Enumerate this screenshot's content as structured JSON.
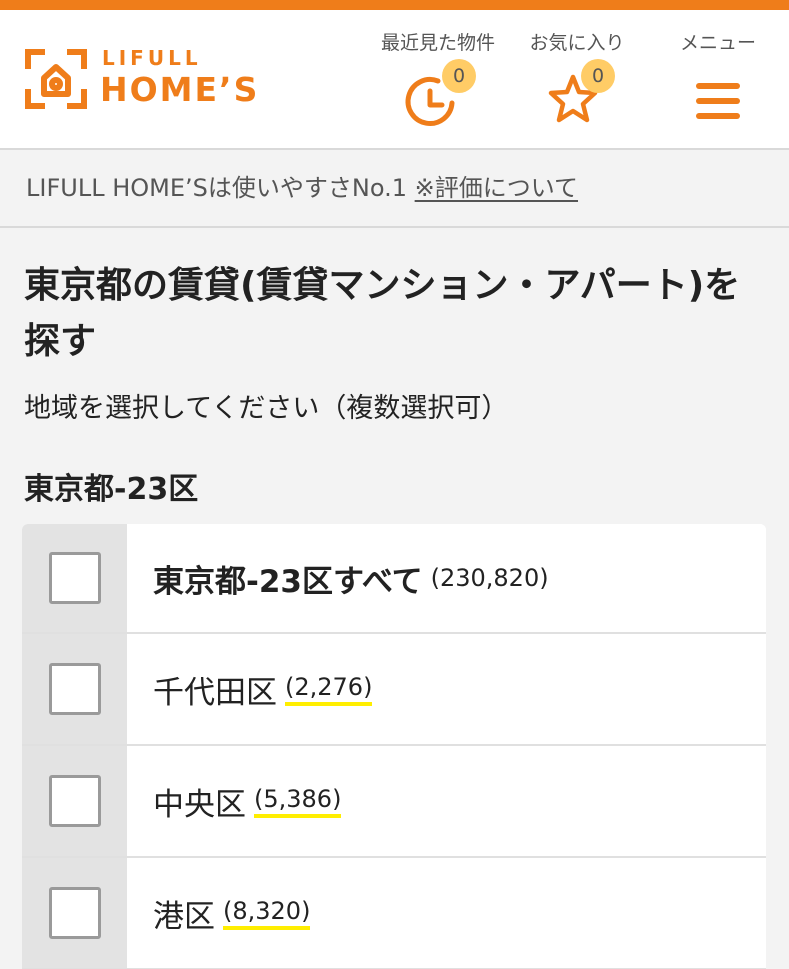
{
  "brand": {
    "logo_small": "LIFULL",
    "logo_big": "HOME’S",
    "color": "#ef7d1a"
  },
  "header": {
    "recent": {
      "label": "最近見た物件",
      "count": "0",
      "icon": "clock-icon"
    },
    "favorites": {
      "label": "お気に入り",
      "count": "0",
      "icon": "star-icon"
    },
    "menu": {
      "label": "メニュー",
      "icon": "hamburger-menu-icon"
    }
  },
  "info_bar": {
    "text": "LIFULL HOME’Sは使いやすさNo.1",
    "link": "※評価について"
  },
  "page": {
    "title": "東京都の賃貸(賃貸マンション・アパート)を探す",
    "instruction": "地域を選択してください（複数選択可）",
    "section_title": "東京都-23区"
  },
  "areas": [
    {
      "name": "東京都-23区すべて",
      "count": "(230,820)"
    },
    {
      "name": "千代田区",
      "count": "(2,276)"
    },
    {
      "name": "中央区",
      "count": "(5,386)"
    },
    {
      "name": "港区",
      "count": "(8,320)"
    }
  ]
}
